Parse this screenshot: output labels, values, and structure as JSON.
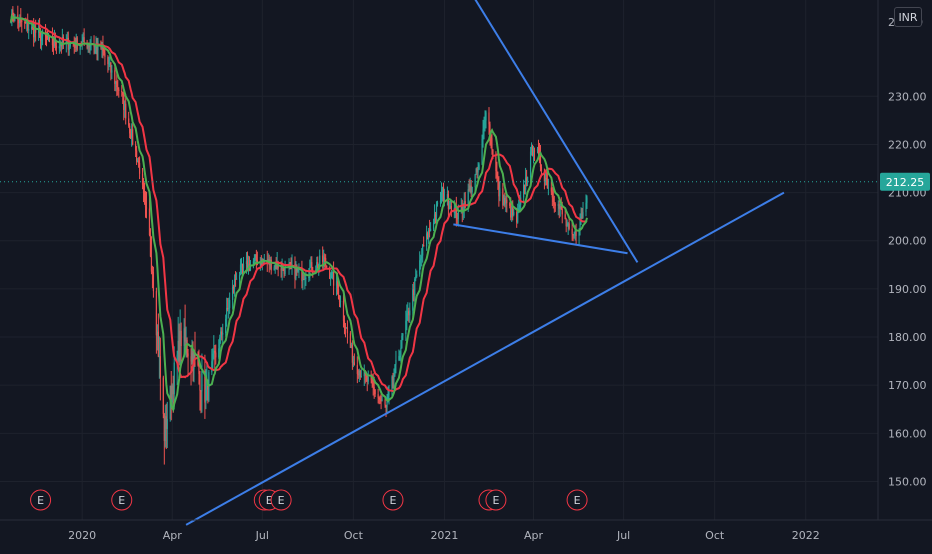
{
  "currency_badge": "INR",
  "price_axis_top_fragment": "2",
  "price_axis_top_suffix": "0",
  "last_price_label": "212.25",
  "event_marker_letter": "E",
  "colors": {
    "background": "#131722",
    "grid": "#1e222d",
    "candle_up": "#26a69a",
    "candle_down": "#ef5350",
    "ma_fast": "#4caf50",
    "ma_slow": "#f23645",
    "trendline": "#3d7ee8",
    "last_price_badge": "#26a69a",
    "event_marker": "#f23645",
    "text": "#b2b5be"
  },
  "chart_data": {
    "type": "candlestick",
    "y_axis_ticks": [
      "150.00",
      "160.00",
      "170.00",
      "180.00",
      "190.00",
      "200.00",
      "210.00",
      "220.00",
      "230.00"
    ],
    "x_axis_ticks": [
      "2020",
      "Apr",
      "Jul",
      "Oct",
      "2021",
      "Apr",
      "Jul",
      "Oct",
      "2022"
    ],
    "ylim": [
      142,
      250
    ],
    "xlim": [
      "2019-10-10",
      "2022-03-15"
    ],
    "last_price": 212.25,
    "price_path": [
      [
        "2019-10-20",
        247
      ],
      [
        "2019-12-01",
        241
      ],
      [
        "2020-01-10",
        241
      ],
      [
        "2020-01-20",
        240
      ],
      [
        "2020-02-10",
        230
      ],
      [
        "2020-02-28",
        215
      ],
      [
        "2020-03-12",
        195
      ],
      [
        "2020-03-24",
        160
      ],
      [
        "2020-04-01",
        170
      ],
      [
        "2020-04-10",
        180
      ],
      [
        "2020-04-22",
        176
      ],
      [
        "2020-05-05",
        168
      ],
      [
        "2020-05-20",
        180
      ],
      [
        "2020-06-05",
        193
      ],
      [
        "2020-06-25",
        196
      ],
      [
        "2020-07-15",
        195
      ],
      [
        "2020-08-10",
        193
      ],
      [
        "2020-09-01",
        196
      ],
      [
        "2020-09-15",
        190
      ],
      [
        "2020-10-01",
        175
      ],
      [
        "2020-10-25",
        168
      ],
      [
        "2020-11-03",
        165
      ],
      [
        "2020-11-20",
        180
      ],
      [
        "2020-12-10",
        198
      ],
      [
        "2020-12-30",
        210
      ],
      [
        "2021-01-15",
        205
      ],
      [
        "2021-02-05",
        215
      ],
      [
        "2021-02-12",
        228
      ],
      [
        "2021-02-25",
        210
      ],
      [
        "2021-03-15",
        204
      ],
      [
        "2021-04-01",
        220
      ],
      [
        "2021-04-15",
        212
      ],
      [
        "2021-05-01",
        205
      ],
      [
        "2021-05-10",
        200
      ],
      [
        "2021-05-20",
        205
      ],
      [
        "2021-05-25",
        209
      ]
    ],
    "trendlines": [
      {
        "name": "upper",
        "from": [
          "2021-01-25",
          252.5
        ],
        "to": [
          "2021-07-15",
          195.5
        ]
      },
      {
        "name": "lower",
        "from": [
          "2021-01-10",
          203.4
        ],
        "to": [
          "2021-07-05",
          197.4
        ]
      },
      {
        "name": "support",
        "from": [
          "2020-04-15",
          141
        ],
        "to": [
          "2021-12-10",
          210
        ]
      }
    ],
    "event_dates": [
      "2019-11-20",
      "2020-02-10",
      "2020-07-03",
      "2020-07-08",
      "2020-07-20",
      "2020-11-10",
      "2021-02-15",
      "2021-02-22",
      "2021-05-15"
    ]
  }
}
